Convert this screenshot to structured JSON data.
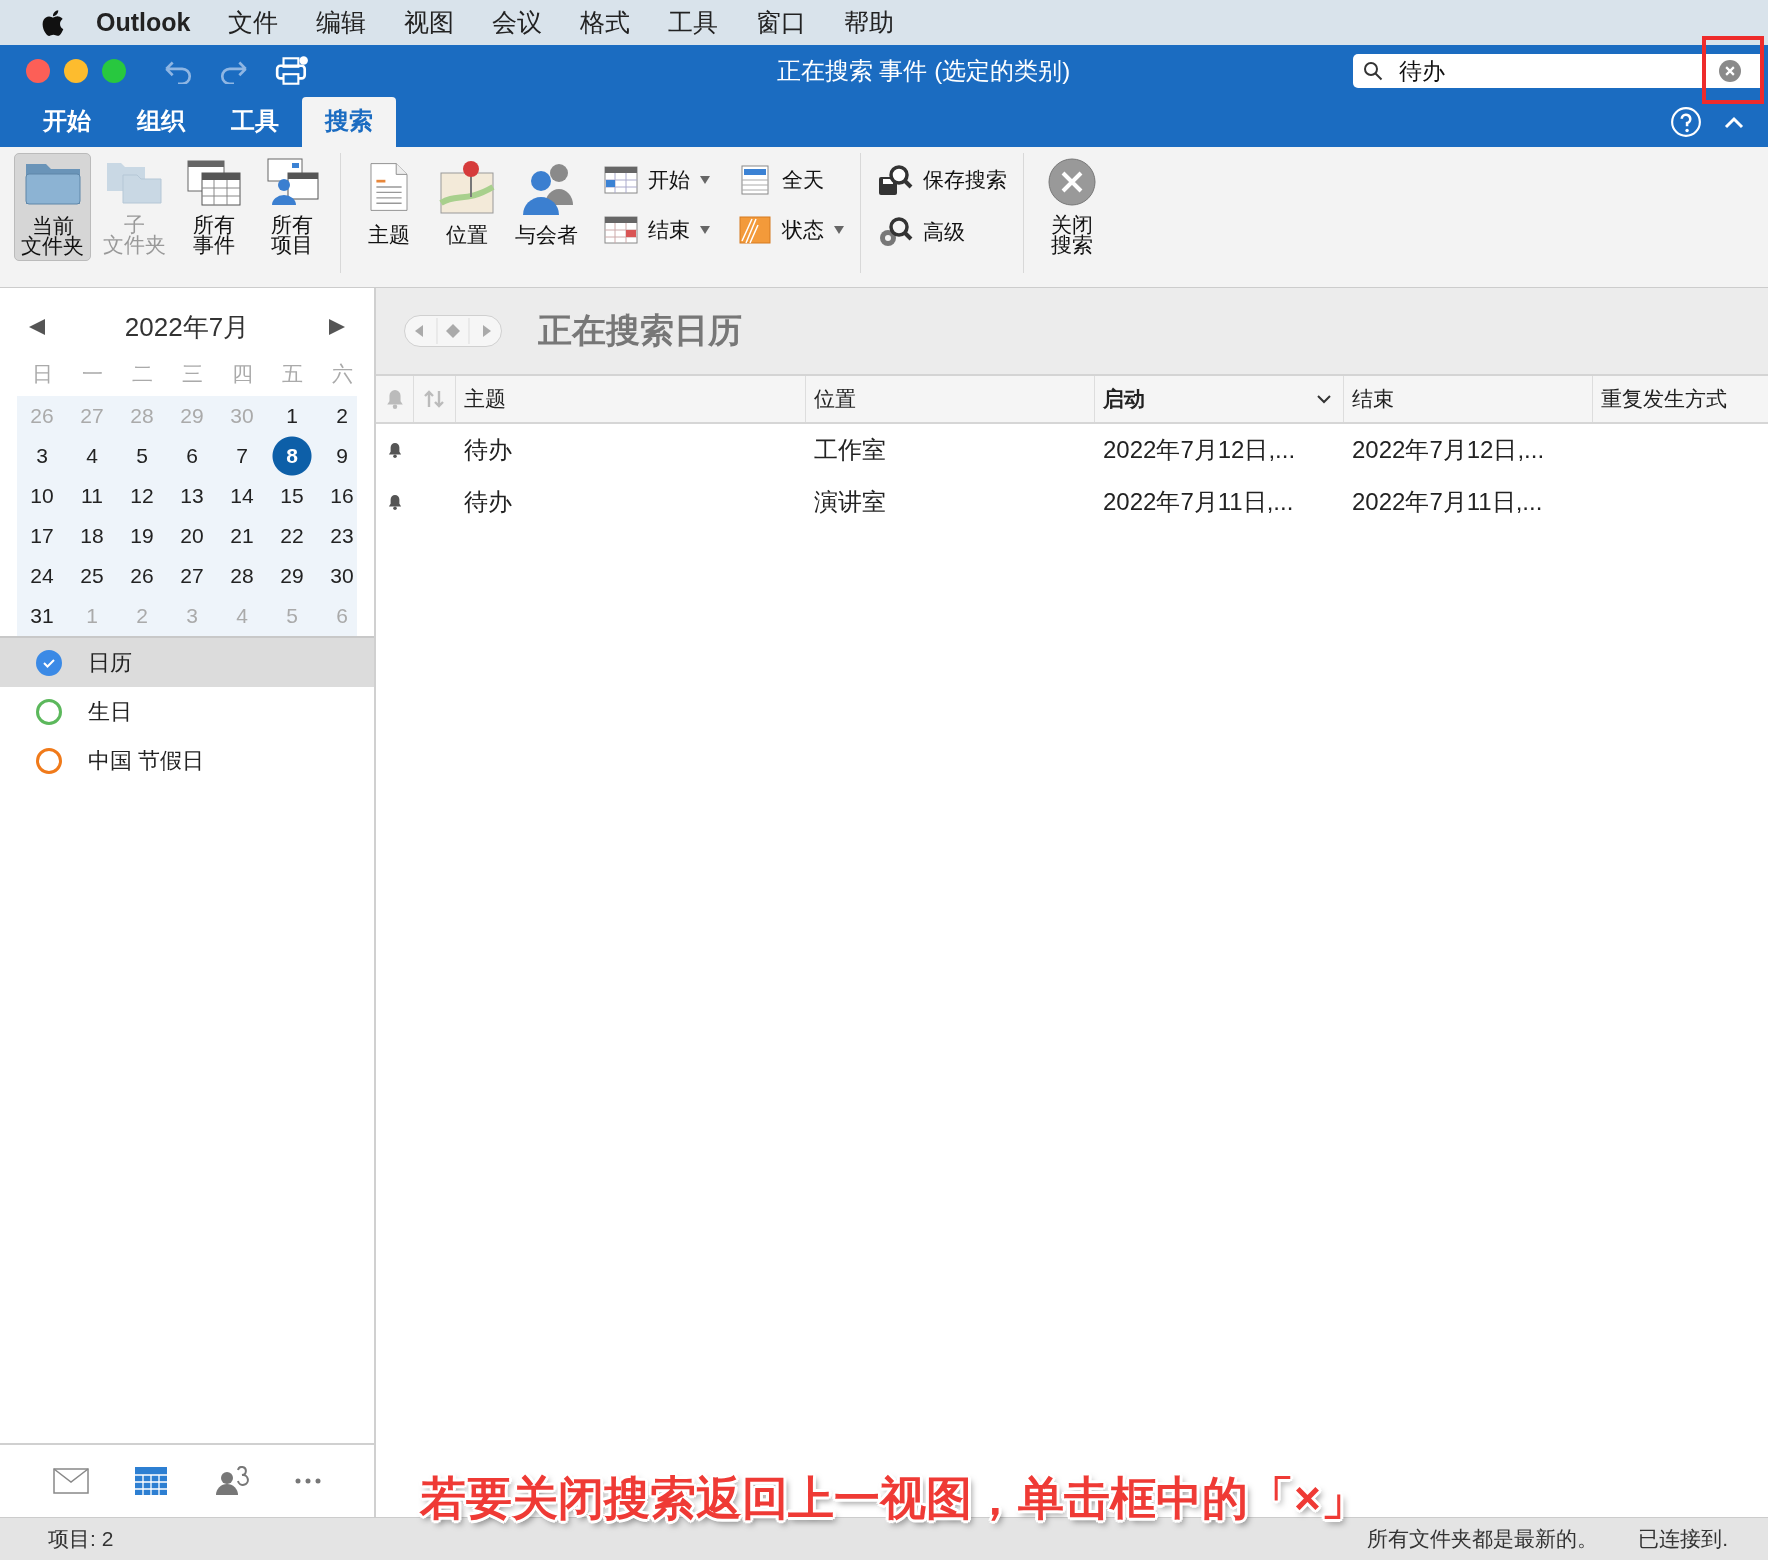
{
  "menu_bar": {
    "app": "Outlook",
    "items": [
      "文件",
      "编辑",
      "视图",
      "会议",
      "格式",
      "工具",
      "窗口",
      "帮助"
    ]
  },
  "window": {
    "title": "正在搜索 事件 (选定的类别)",
    "search": {
      "value": "待办"
    },
    "tabs": [
      {
        "label": "开始",
        "selected": false
      },
      {
        "label": "组织",
        "selected": false
      },
      {
        "label": "工具",
        "selected": false
      },
      {
        "label": "搜索",
        "selected": true
      }
    ]
  },
  "ribbon": {
    "scope_buttons": [
      {
        "kind": "folder",
        "label": [
          "当前",
          "文件夹"
        ],
        "selected": true,
        "disabled": false
      },
      {
        "kind": "subfolder",
        "label": [
          "子",
          "文件夹"
        ],
        "selected": false,
        "disabled": true
      },
      {
        "kind": "events",
        "label": [
          "所有",
          "事件"
        ],
        "selected": false,
        "disabled": false
      },
      {
        "kind": "items",
        "label": [
          "所有",
          "项目"
        ],
        "selected": false,
        "disabled": false
      }
    ],
    "refine_buttons": [
      {
        "kind": "subject",
        "label": "主题"
      },
      {
        "kind": "location",
        "label": "位置"
      },
      {
        "kind": "attendees",
        "label": "与会者"
      }
    ],
    "small_buttons": [
      {
        "kind": "start",
        "label": "开始",
        "dropdown": true
      },
      {
        "kind": "allday",
        "label": "全天",
        "dropdown": false
      },
      {
        "kind": "end",
        "label": "结束",
        "dropdown": true
      },
      {
        "kind": "status",
        "label": "状态",
        "dropdown": true
      }
    ],
    "save_buttons": [
      {
        "kind": "save",
        "label": "保存搜索"
      },
      {
        "kind": "advanced",
        "label": "高级"
      }
    ],
    "close_button": {
      "label": [
        "关闭",
        "搜索"
      ]
    }
  },
  "calendar": {
    "title": "2022年7月",
    "weekdays": [
      "日",
      "一",
      "二",
      "三",
      "四",
      "五",
      "六"
    ],
    "weeks": [
      [
        {
          "day": "26",
          "in_month": false,
          "selected": false
        },
        {
          "day": "27",
          "in_month": false,
          "selected": false
        },
        {
          "day": "28",
          "in_month": false,
          "selected": false
        },
        {
          "day": "29",
          "in_month": false,
          "selected": false
        },
        {
          "day": "30",
          "in_month": false,
          "selected": false
        },
        {
          "day": "1",
          "in_month": true,
          "selected": false
        },
        {
          "day": "2",
          "in_month": true,
          "selected": false
        }
      ],
      [
        {
          "day": "3",
          "in_month": true,
          "selected": false
        },
        {
          "day": "4",
          "in_month": true,
          "selected": false
        },
        {
          "day": "5",
          "in_month": true,
          "selected": false
        },
        {
          "day": "6",
          "in_month": true,
          "selected": false
        },
        {
          "day": "7",
          "in_month": true,
          "selected": false
        },
        {
          "day": "8",
          "in_month": true,
          "selected": true
        },
        {
          "day": "9",
          "in_month": true,
          "selected": false
        }
      ],
      [
        {
          "day": "10",
          "in_month": true,
          "selected": false
        },
        {
          "day": "11",
          "in_month": true,
          "selected": false
        },
        {
          "day": "12",
          "in_month": true,
          "selected": false
        },
        {
          "day": "13",
          "in_month": true,
          "selected": false
        },
        {
          "day": "14",
          "in_month": true,
          "selected": false
        },
        {
          "day": "15",
          "in_month": true,
          "selected": false
        },
        {
          "day": "16",
          "in_month": true,
          "selected": false
        }
      ],
      [
        {
          "day": "17",
          "in_month": true,
          "selected": false
        },
        {
          "day": "18",
          "in_month": true,
          "selected": false
        },
        {
          "day": "19",
          "in_month": true,
          "selected": false
        },
        {
          "day": "20",
          "in_month": true,
          "selected": false
        },
        {
          "day": "21",
          "in_month": true,
          "selected": false
        },
        {
          "day": "22",
          "in_month": true,
          "selected": false
        },
        {
          "day": "23",
          "in_month": true,
          "selected": false
        }
      ],
      [
        {
          "day": "24",
          "in_month": true,
          "selected": false
        },
        {
          "day": "25",
          "in_month": true,
          "selected": false
        },
        {
          "day": "26",
          "in_month": true,
          "selected": false
        },
        {
          "day": "27",
          "in_month": true,
          "selected": false
        },
        {
          "day": "28",
          "in_month": true,
          "selected": false
        },
        {
          "day": "29",
          "in_month": true,
          "selected": false
        },
        {
          "day": "30",
          "in_month": true,
          "selected": false
        }
      ],
      [
        {
          "day": "31",
          "in_month": true,
          "selected": false
        },
        {
          "day": "1",
          "in_month": false,
          "selected": false
        },
        {
          "day": "2",
          "in_month": false,
          "selected": false
        },
        {
          "day": "3",
          "in_month": false,
          "selected": false
        },
        {
          "day": "4",
          "in_month": false,
          "selected": false
        },
        {
          "day": "5",
          "in_month": false,
          "selected": false
        },
        {
          "day": "6",
          "in_month": false,
          "selected": false
        }
      ]
    ]
  },
  "calendars": [
    {
      "label": "日历",
      "checked": true,
      "selected": true,
      "color": "#3b8ae6"
    },
    {
      "label": "生日",
      "checked": false,
      "selected": false,
      "color": "#5cb85c"
    },
    {
      "label": "中国 节假日",
      "checked": false,
      "selected": false,
      "color": "#f07a1a"
    }
  ],
  "search_heading": "正在搜索日历",
  "table": {
    "columns": [
      {
        "label": "主题",
        "sorted": false
      },
      {
        "label": "位置",
        "sorted": false
      },
      {
        "label": "启动",
        "sorted": true
      },
      {
        "label": "结束",
        "sorted": false
      },
      {
        "label": "重复发生方式",
        "sorted": false
      }
    ],
    "rows": [
      {
        "reminder": true,
        "cells": [
          "待办",
          "工作室",
          "2022年7月12日,...",
          "2022年7月12日,...",
          ""
        ]
      },
      {
        "reminder": true,
        "cells": [
          "待办",
          "演讲室",
          "2022年7月11日,...",
          "2022年7月11日,...",
          ""
        ]
      }
    ]
  },
  "status_bar": {
    "count": "项目: 2",
    "sync": "所有文件夹都是最新的。",
    "connection": "已连接到."
  },
  "annotation": {
    "caption": "若要关闭搜索返回上一视图，单击框中的「×」"
  }
}
